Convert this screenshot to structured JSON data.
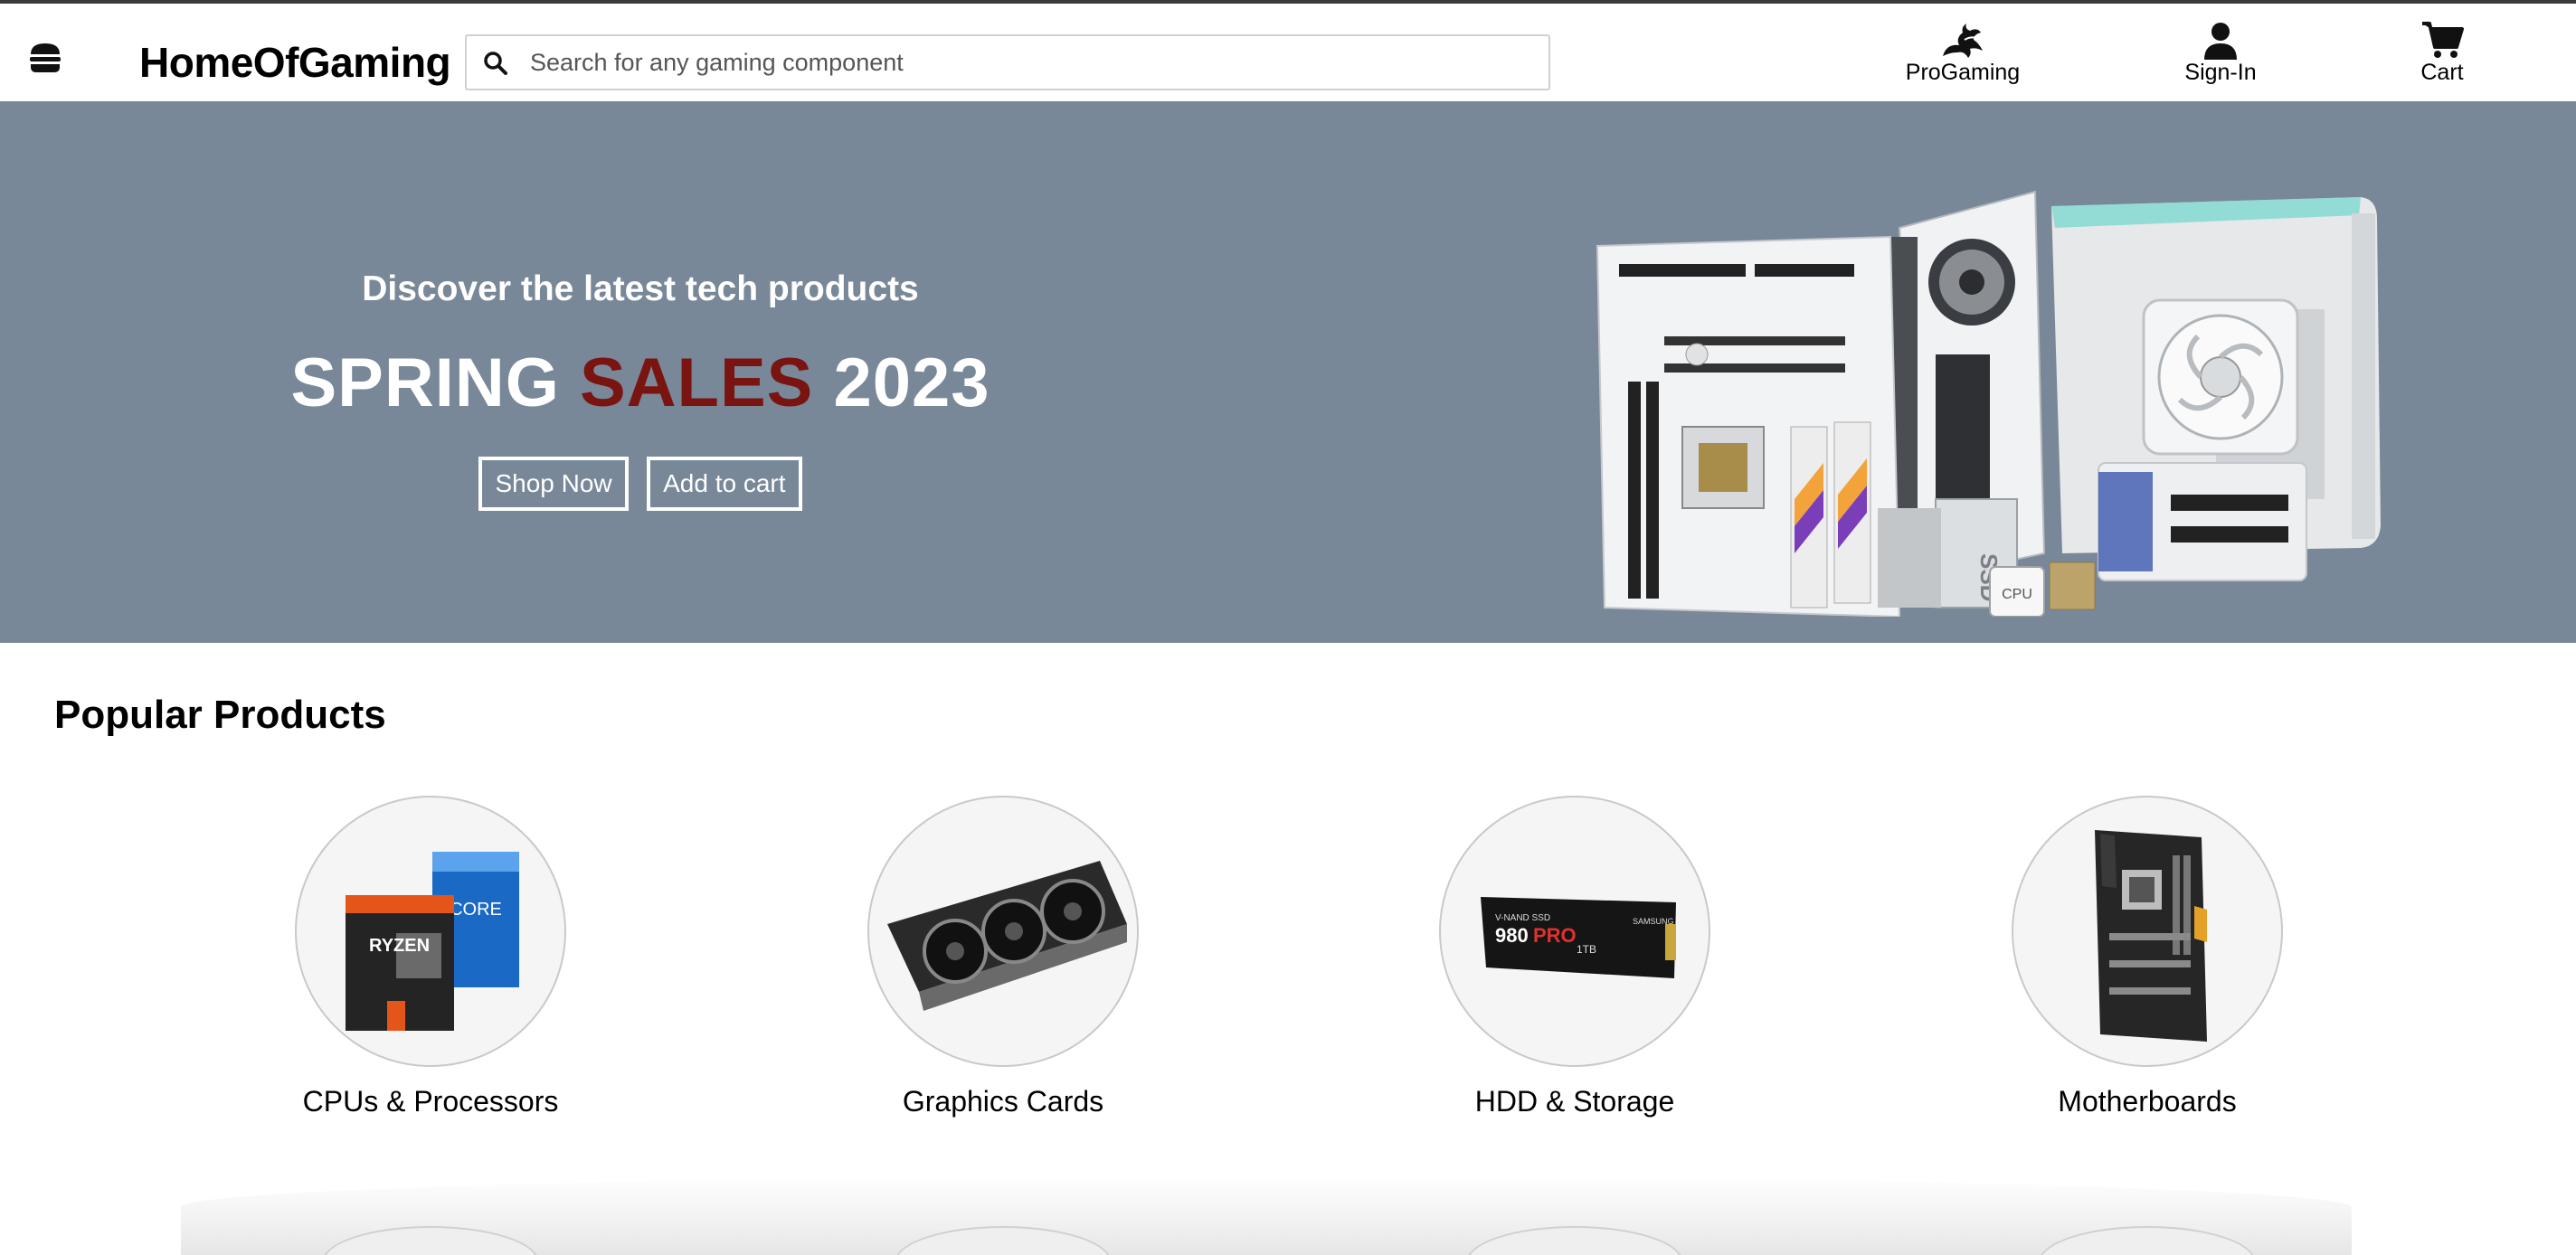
{
  "header": {
    "brand": "HomeOfGaming",
    "search_placeholder": "Search for any gaming component",
    "nav": [
      {
        "label": "ProGaming",
        "icon": "dragon-icon"
      },
      {
        "label": "Sign-In",
        "icon": "user-icon"
      },
      {
        "label": "Cart",
        "icon": "cart-icon"
      }
    ]
  },
  "hero": {
    "tagline": "Discover the latest tech products",
    "title_part1": "SPRING ",
    "title_accent": "SALES",
    "title_part2": " 2023",
    "buttons": [
      "Shop Now",
      "Add to cart"
    ],
    "background_color": "#788899",
    "accent_color": "#7a1410",
    "image": "pc-components-bundle"
  },
  "popular": {
    "title": "Popular Products",
    "items": [
      {
        "label": "CPUs & Processors",
        "image": "cpu-boxes"
      },
      {
        "label": "Graphics Cards",
        "image": "graphics-card"
      },
      {
        "label": "HDD & Storage",
        "image": "nvme-ssd",
        "image_text": {
          "brand": "V-NAND SSD",
          "model": "980",
          "series": "PRO",
          "capacity": "1TB",
          "maker": "SAMSUNG"
        }
      },
      {
        "label": "Motherboards",
        "image": "motherboard"
      }
    ]
  }
}
